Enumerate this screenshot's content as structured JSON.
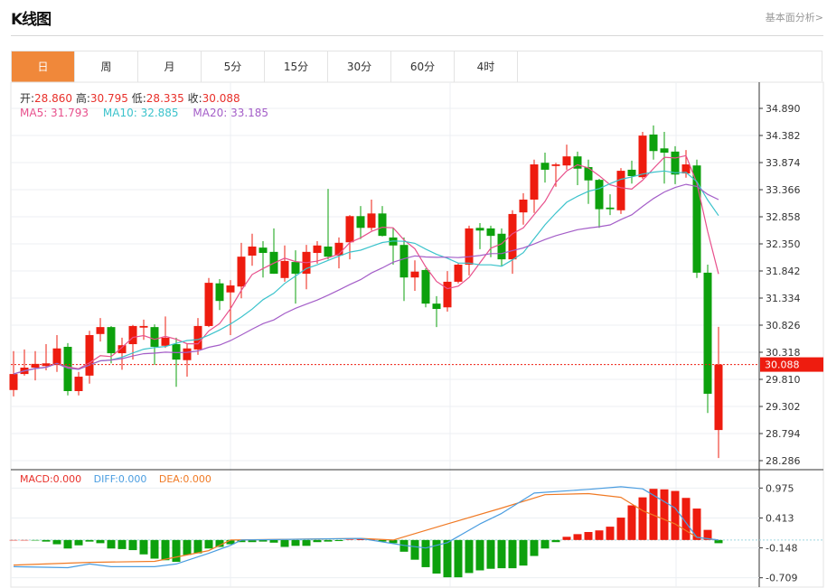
{
  "header": {
    "title": "K线图",
    "link": "基本面分析>"
  },
  "tabs": [
    "日",
    "周",
    "月",
    "5分",
    "15分",
    "30分",
    "60分",
    "4时"
  ],
  "active_tab": 0,
  "ohlc": {
    "open_label": "开:",
    "open": "28.860",
    "high_label": "高:",
    "high": "30.795",
    "low_label": "低:",
    "low": "28.335",
    "close_label": "收:",
    "close": "30.088"
  },
  "ma": {
    "ma5_label": "MA5: 31.793",
    "ma10_label": "MA10: 32.885",
    "ma20_label": "MA20: 33.185"
  },
  "macd_legend": {
    "macd": "MACD:0.000",
    "diff": "DIFF:0.000",
    "dea": "DEA:0.000"
  },
  "colors": {
    "up": "#ee1c0f",
    "down": "#0da10d",
    "ma5": "#e8508c",
    "ma10": "#3cc3cc",
    "ma20": "#a45ec8",
    "diff": "#4a9de0",
    "dea": "#f07a25",
    "accent": "#f0883a"
  },
  "chart_data": {
    "type": "candlestick",
    "price_axis": {
      "ticks": [
        "34.890",
        "34.382",
        "33.874",
        "33.366",
        "32.858",
        "32.350",
        "31.842",
        "31.334",
        "30.826",
        "30.318",
        "29.810",
        "29.302",
        "28.794",
        "28.286"
      ],
      "range": [
        28.286,
        34.89
      ]
    },
    "current_price": "30.088",
    "candles_ohlc": [
      [
        29.61,
        29.91,
        30.34,
        29.49
      ],
      [
        29.91,
        30.03,
        30.37,
        29.88
      ],
      [
        30.03,
        30.1,
        30.34,
        29.79
      ],
      [
        30.06,
        30.11,
        30.47,
        29.98
      ],
      [
        30.08,
        30.39,
        30.64,
        29.95
      ],
      [
        30.42,
        29.59,
        30.49,
        29.51
      ],
      [
        29.59,
        29.86,
        29.95,
        29.51
      ],
      [
        29.88,
        30.64,
        30.72,
        29.73
      ],
      [
        30.66,
        30.79,
        30.96,
        30.52
      ],
      [
        30.79,
        30.3,
        30.81,
        30.11
      ],
      [
        30.3,
        30.45,
        30.59,
        29.99
      ],
      [
        30.47,
        30.81,
        30.83,
        30.18
      ],
      [
        30.78,
        30.81,
        30.93,
        30.55
      ],
      [
        30.79,
        30.42,
        30.84,
        30.08
      ],
      [
        30.44,
        30.59,
        30.99,
        30.4
      ],
      [
        30.47,
        30.18,
        30.59,
        29.67
      ],
      [
        30.17,
        30.39,
        30.49,
        29.86
      ],
      [
        30.37,
        30.81,
        30.96,
        30.27
      ],
      [
        30.81,
        31.62,
        31.71,
        30.79
      ],
      [
        31.61,
        31.28,
        31.69,
        31.11
      ],
      [
        31.44,
        31.57,
        31.67,
        30.64
      ],
      [
        31.55,
        32.11,
        32.37,
        31.33
      ],
      [
        32.13,
        32.3,
        32.54,
        31.94
      ],
      [
        32.28,
        32.18,
        32.4,
        31.72
      ],
      [
        32.2,
        31.79,
        32.64,
        31.79
      ],
      [
        31.71,
        32.03,
        32.32,
        31.64
      ],
      [
        32.01,
        31.79,
        32.23,
        31.23
      ],
      [
        31.79,
        32.2,
        32.33,
        31.5
      ],
      [
        32.18,
        32.32,
        32.4,
        31.98
      ],
      [
        32.3,
        32.11,
        33.38,
        32.06
      ],
      [
        32.13,
        32.37,
        32.47,
        31.89
      ],
      [
        32.38,
        32.87,
        32.89,
        32.06
      ],
      [
        32.87,
        32.65,
        33.06,
        32.44
      ],
      [
        32.65,
        32.92,
        33.18,
        32.6
      ],
      [
        32.92,
        32.5,
        33.06,
        32.49
      ],
      [
        32.47,
        32.32,
        32.65,
        31.96
      ],
      [
        32.33,
        31.72,
        32.47,
        31.28
      ],
      [
        31.72,
        31.83,
        32.04,
        31.47
      ],
      [
        31.86,
        31.23,
        31.89,
        31.16
      ],
      [
        31.23,
        31.13,
        31.37,
        30.79
      ],
      [
        31.16,
        31.64,
        31.84,
        31.08
      ],
      [
        31.64,
        31.96,
        31.99,
        31.61
      ],
      [
        31.96,
        32.64,
        32.69,
        31.76
      ],
      [
        32.65,
        32.6,
        32.74,
        32.25
      ],
      [
        32.64,
        32.5,
        32.69,
        32.1
      ],
      [
        32.54,
        32.06,
        32.64,
        31.93
      ],
      [
        32.06,
        32.91,
        32.98,
        31.79
      ],
      [
        32.94,
        33.18,
        33.3,
        32.71
      ],
      [
        33.18,
        33.84,
        33.93,
        32.93
      ],
      [
        33.87,
        33.74,
        34.06,
        33.5
      ],
      [
        33.81,
        33.84,
        33.87,
        33.42
      ],
      [
        33.82,
        33.99,
        34.21,
        33.74
      ],
      [
        33.99,
        33.76,
        34.08,
        33.45
      ],
      [
        33.79,
        33.54,
        33.93,
        33.1
      ],
      [
        33.55,
        33.0,
        33.57,
        32.65
      ],
      [
        33.03,
        33.0,
        33.28,
        32.89
      ],
      [
        32.98,
        33.72,
        33.77,
        32.91
      ],
      [
        33.74,
        33.62,
        33.91,
        33.48
      ],
      [
        33.6,
        34.38,
        34.45,
        33.57
      ],
      [
        34.4,
        34.09,
        34.57,
        33.93
      ],
      [
        34.14,
        34.06,
        34.45,
        33.48
      ],
      [
        34.08,
        33.65,
        34.18,
        33.47
      ],
      [
        33.67,
        33.84,
        34.11,
        33.59
      ],
      [
        33.82,
        31.81,
        33.93,
        31.71
      ],
      [
        31.81,
        29.54,
        31.96,
        29.18
      ],
      [
        28.86,
        30.088,
        30.795,
        28.335
      ]
    ],
    "ma_periods": [
      5,
      10,
      20
    ],
    "macd": {
      "axis_ticks": [
        "0.975",
        "0.413",
        "-0.148",
        "-0.709"
      ],
      "range": [
        -0.85,
        1.15
      ],
      "histogram": [
        0,
        0,
        -0.01,
        -0.03,
        -0.08,
        -0.16,
        -0.1,
        -0.03,
        -0.06,
        -0.16,
        -0.17,
        -0.19,
        -0.27,
        -0.35,
        -0.38,
        -0.41,
        -0.28,
        -0.25,
        -0.16,
        -0.13,
        -0.08,
        -0.04,
        -0.04,
        -0.03,
        -0.05,
        -0.13,
        -0.11,
        -0.11,
        -0.04,
        -0.03,
        -0.02,
        0.01,
        0.02,
        0.02,
        -0.03,
        -0.06,
        -0.22,
        -0.37,
        -0.51,
        -0.63,
        -0.7,
        -0.7,
        -0.62,
        -0.57,
        -0.54,
        -0.53,
        -0.53,
        -0.48,
        -0.3,
        -0.16,
        -0.04,
        0.06,
        0.11,
        0.15,
        0.18,
        0.25,
        0.42,
        0.65,
        0.8,
        0.96,
        0.95,
        0.92,
        0.79,
        0.59,
        0.19,
        -0.06
      ],
      "diff_points": [
        [
          1,
          -0.5
        ],
        [
          6,
          -0.52
        ],
        [
          8,
          -0.45
        ],
        [
          10,
          -0.5
        ],
        [
          14,
          -0.5
        ],
        [
          16,
          -0.45
        ],
        [
          19,
          -0.25
        ],
        [
          21,
          -0.1
        ],
        [
          22,
          0.0
        ],
        [
          33,
          0.03
        ],
        [
          37,
          -0.1
        ],
        [
          39,
          -0.15
        ],
        [
          41,
          -0.05
        ],
        [
          44,
          0.3
        ],
        [
          46,
          0.5
        ],
        [
          49,
          0.88
        ],
        [
          54,
          0.95
        ],
        [
          57,
          1.0
        ],
        [
          59,
          0.96
        ],
        [
          62,
          0.6
        ],
        [
          64,
          0.05
        ],
        [
          66,
          0.0
        ]
      ],
      "dea_points": [
        [
          1,
          -0.47
        ],
        [
          8,
          -0.42
        ],
        [
          14,
          -0.4
        ],
        [
          19,
          -0.2
        ],
        [
          21,
          0.0
        ],
        [
          33,
          0.03
        ],
        [
          36,
          0.0
        ],
        [
          41,
          0.3
        ],
        [
          46,
          0.6
        ],
        [
          50,
          0.85
        ],
        [
          54,
          0.87
        ],
        [
          57,
          0.8
        ],
        [
          59,
          0.55
        ],
        [
          62,
          0.3
        ],
        [
          64,
          0.05
        ],
        [
          66,
          0.0
        ]
      ]
    }
  }
}
